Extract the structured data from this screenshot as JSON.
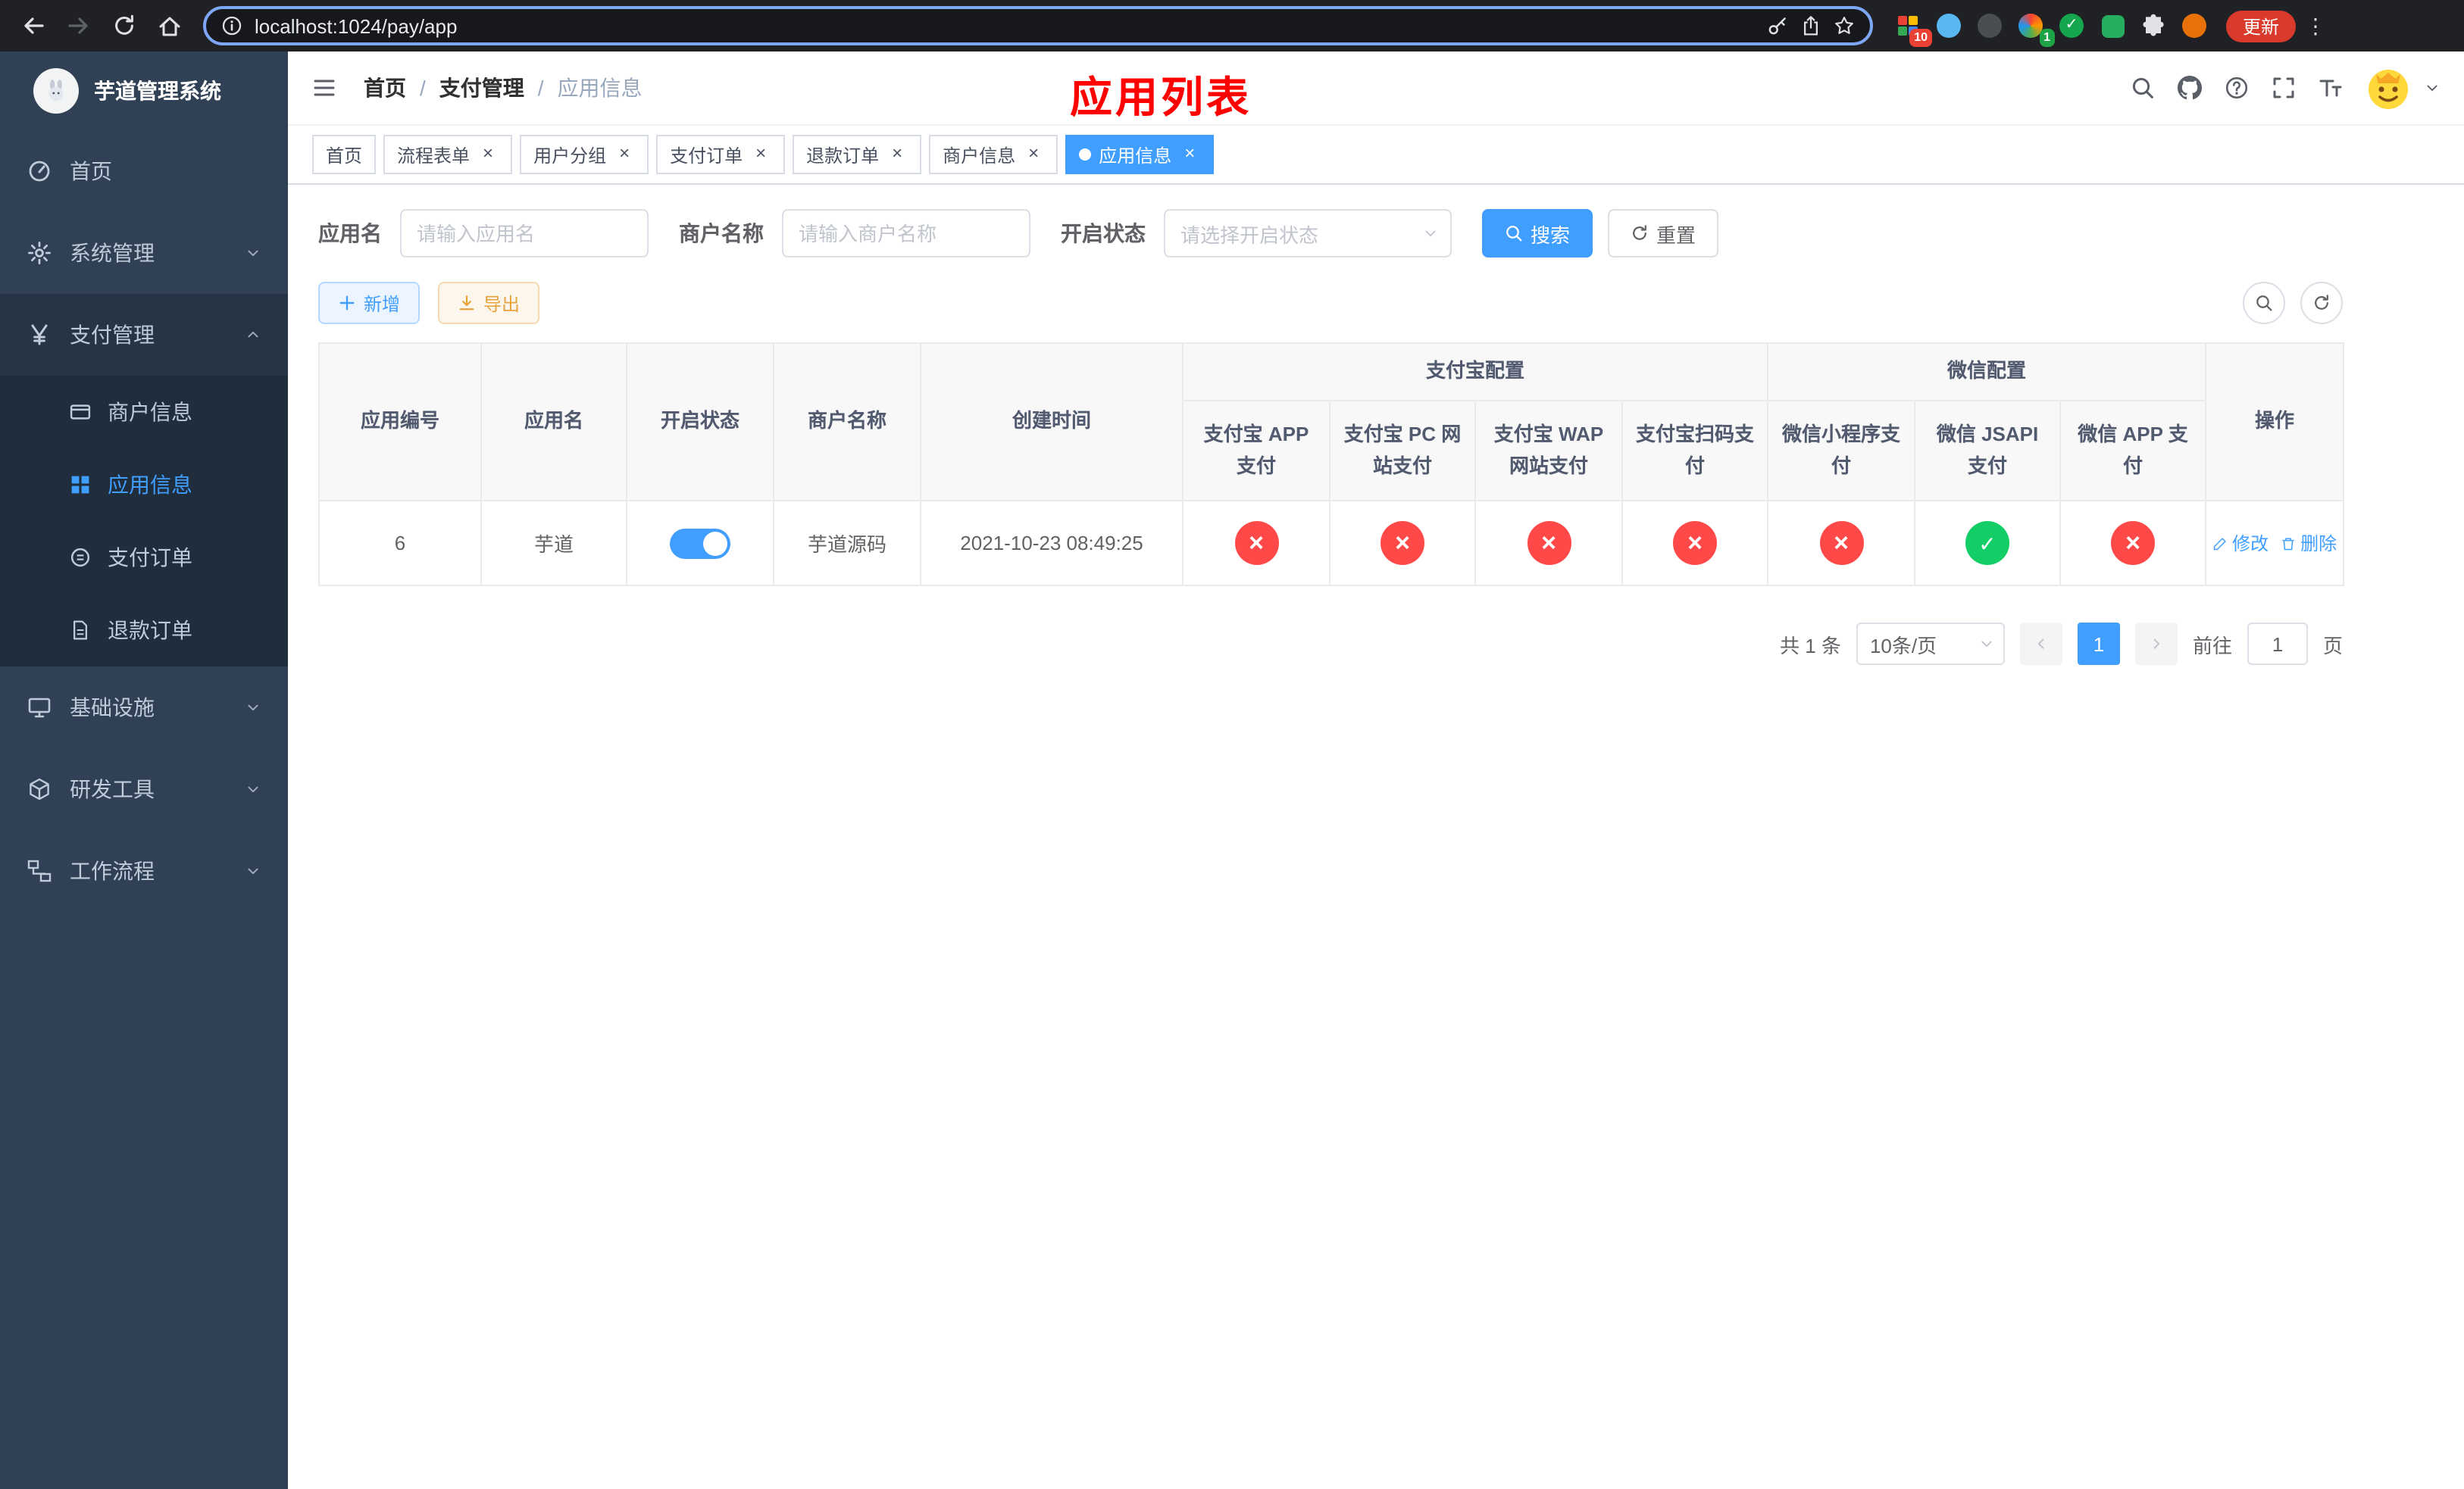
{
  "colors": {
    "accent": "#409eff",
    "danger": "#ff4949",
    "success": "#13ce66",
    "title_red": "#ff0000",
    "sidebar_bg": "#304156",
    "sidebar_submenu_bg": "#1f2d3d"
  },
  "browser": {
    "url": "localhost:1024/pay/app",
    "update_label": "更新",
    "ext_badge_red": "10",
    "ext_badge_green": "1"
  },
  "sidebar": {
    "title": "芋道管理系统",
    "items": [
      {
        "label": "首页"
      },
      {
        "label": "系统管理"
      },
      {
        "label": "支付管理",
        "children": [
          {
            "label": "商户信息"
          },
          {
            "label": "应用信息"
          },
          {
            "label": "支付订单"
          },
          {
            "label": "退款订单"
          }
        ]
      },
      {
        "label": "基础设施"
      },
      {
        "label": "研发工具"
      },
      {
        "label": "工作流程"
      }
    ]
  },
  "header": {
    "breadcrumb": [
      "首页",
      "支付管理",
      "应用信息"
    ],
    "breadcrumb_separator": "/",
    "overlay_title": "应用列表"
  },
  "tabs": [
    {
      "label": "首页"
    },
    {
      "label": "流程表单"
    },
    {
      "label": "用户分组"
    },
    {
      "label": "支付订单"
    },
    {
      "label": "退款订单"
    },
    {
      "label": "商户信息"
    },
    {
      "label": "应用信息"
    }
  ],
  "filters": {
    "app_name_label": "应用名",
    "app_name_placeholder": "请输入应用名",
    "merchant_label": "商户名称",
    "merchant_placeholder": "请输入商户名称",
    "status_label": "开启状态",
    "status_placeholder": "请选择开启状态",
    "search_label": "搜索",
    "reset_label": "重置"
  },
  "toolbar": {
    "add_label": "新增",
    "export_label": "导出"
  },
  "table": {
    "groups": {
      "alipay": "支付宝配置",
      "wechat": "微信配置"
    },
    "columns": {
      "app_id": "应用编号",
      "app_name": "应用名",
      "status": "开启状态",
      "merchant": "商户名称",
      "created": "创建时间",
      "alipay_app": "支付宝 APP 支付",
      "alipay_pc": "支付宝 PC 网站支付",
      "alipay_wap": "支付宝 WAP 网站支付",
      "alipay_qr": "支付宝扫码支付",
      "wx_lite": "微信小程序支付",
      "wx_jsapi": "微信 JSAPI 支付",
      "wx_app": "微信 APP 支付",
      "actions": "操作"
    },
    "rows": [
      {
        "app_id": "6",
        "app_name": "芋道",
        "status": "on",
        "merchant": "芋道源码",
        "created": "2021-10-23 08:49:25",
        "payments": [
          "cross",
          "cross",
          "cross",
          "cross",
          "cross",
          "check",
          "cross"
        ],
        "edit_label": "修改",
        "delete_label": "删除"
      }
    ]
  },
  "pagination": {
    "total": "共 1 条",
    "page_size": "10条/页",
    "page": "1",
    "goto_label": "前往",
    "goto_value": "1",
    "goto_unit": "页"
  },
  "icons": {
    "close": "×",
    "more": "⋮"
  }
}
